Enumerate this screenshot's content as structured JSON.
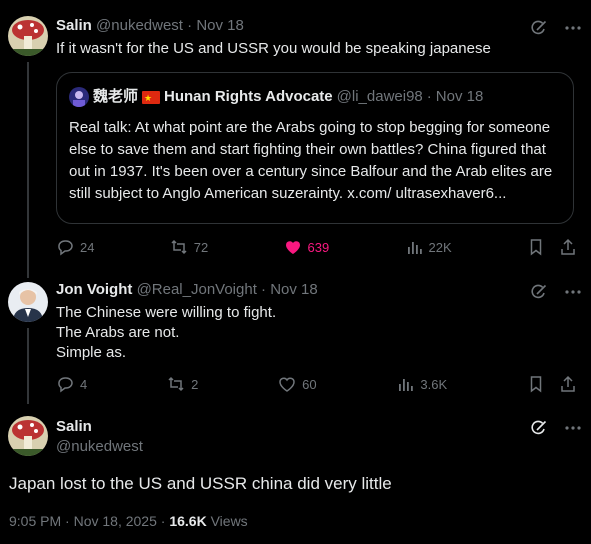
{
  "tweets": [
    {
      "name": "Salin",
      "handle": "@nukedwest",
      "sep": " · ",
      "date": "Nov 18",
      "text": "If it wasn't for the US and USSR you would be speaking japanese",
      "quote": {
        "name": "魏老师",
        "flag_icon": "china-flag-icon",
        "name_suffix": "Hunan Rights Advocate",
        "handle": "@li_dawei98",
        "sep": " · ",
        "date": "Nov 18",
        "text": "Real talk: At what point are the Arabs going to stop begging for someone else to save them and start fighting their own battles? China figured that out in 1937. It's been over a century since Balfour and the Arab elites are still subject to Anglo American suzerainty. x.com/ ultrasexhaver6..."
      },
      "stats": {
        "replies": "24",
        "reposts": "72",
        "likes": "639",
        "views": "22K"
      }
    },
    {
      "name": "Jon Voight",
      "handle": "@Real_JonVoight",
      "sep": " · ",
      "date": "Nov 18",
      "lines": [
        "The Chinese were willing to fight.",
        "The Arabs are not.",
        "Simple as."
      ],
      "stats": {
        "replies": "4",
        "reposts": "2",
        "likes": "60",
        "views": "3.6K"
      }
    }
  ],
  "focused": {
    "name": "Salin",
    "handle": "@nukedwest",
    "text": "Japan lost to the US and USSR china did very little",
    "time": "9:05 PM",
    "sep": " · ",
    "date": "Nov 18, 2025",
    "sep2": " · ",
    "views_count": "16.6K",
    "views_label": " Views"
  },
  "colors": {
    "like": "#f91880",
    "muted": "#71767b",
    "text": "#e7e9ea",
    "background": "#000000"
  }
}
